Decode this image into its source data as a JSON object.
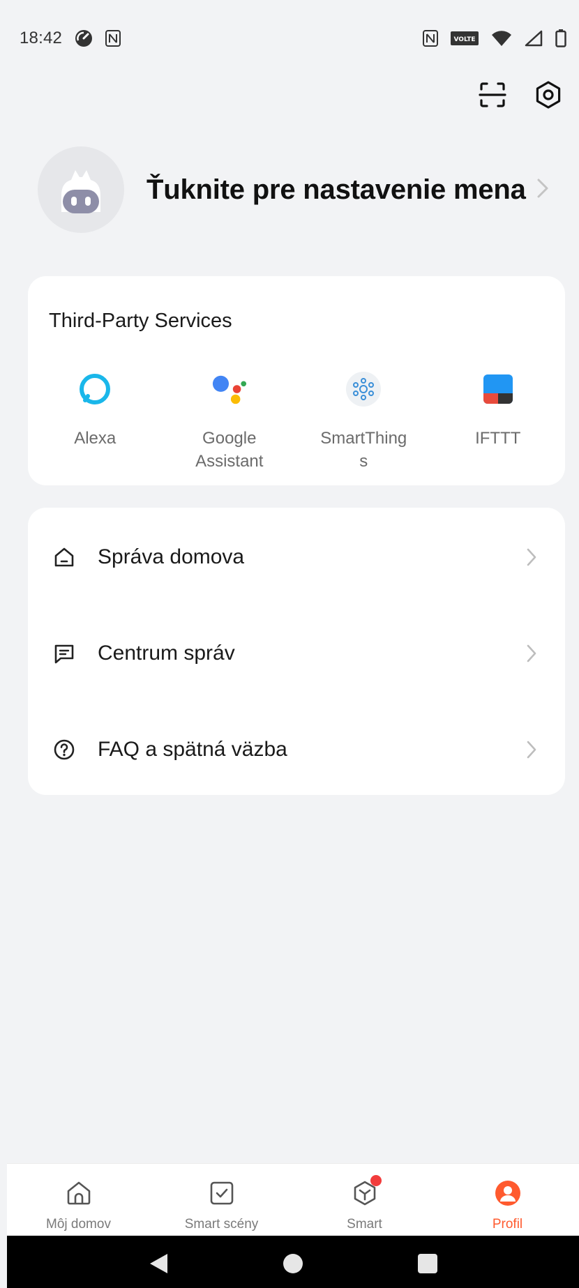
{
  "status_bar": {
    "time": "18:42",
    "left_icons": [
      "speedometer-icon",
      "nfc-icon"
    ],
    "right_icons": [
      "nfc-icon",
      "volte-icon",
      "wifi-icon",
      "signal-icon",
      "battery-icon"
    ],
    "volte_text": "VOLTE"
  },
  "top_actions": [
    "scan-icon",
    "settings-icon"
  ],
  "profile": {
    "name_prompt": "Ťuknite pre nastavenie mena"
  },
  "third_party": {
    "title": "Third-Party Services",
    "services": [
      {
        "label": "Alexa",
        "icon": "alexa-icon"
      },
      {
        "label": "Google\nAssistant",
        "icon": "google-assistant-icon"
      },
      {
        "label": "SmartThing\ns",
        "icon": "smartthings-icon"
      },
      {
        "label": "IFTTT",
        "icon": "ifttt-icon"
      }
    ]
  },
  "menu": {
    "items": [
      {
        "label": "Správa domova",
        "icon": "home-icon"
      },
      {
        "label": "Centrum správ",
        "icon": "message-icon"
      },
      {
        "label": "FAQ a spätná väzba",
        "icon": "help-icon"
      }
    ]
  },
  "bottom_nav": {
    "items": [
      {
        "label": "Môj domov",
        "icon": "home-icon",
        "active": false
      },
      {
        "label": "Smart scény",
        "icon": "checkbox-icon",
        "active": false
      },
      {
        "label": "Smart",
        "icon": "cube-icon",
        "active": false,
        "badge": true
      },
      {
        "label": "Profil",
        "icon": "profile-icon",
        "active": true
      }
    ]
  },
  "colors": {
    "accent": "#ff5a2e",
    "background": "#f2f3f5",
    "card": "#ffffff",
    "alexa": "#1ab7ea",
    "ifttt_blue": "#2196f3",
    "ifttt_red": "#e84b3c"
  }
}
